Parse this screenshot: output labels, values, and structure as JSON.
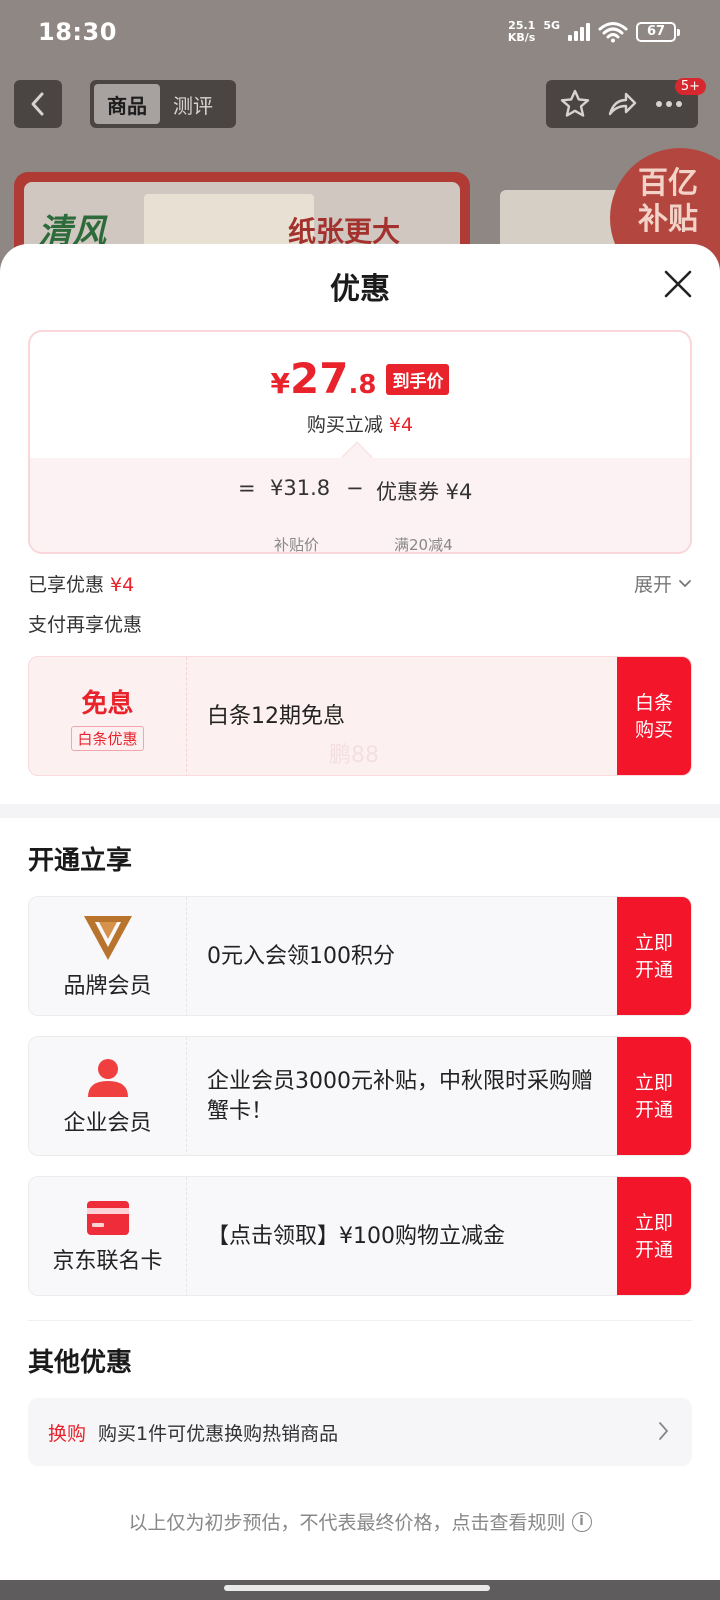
{
  "status_bar": {
    "time": "18:30",
    "net_speed_top": "25.1",
    "net_speed_bottom": "KB/s",
    "network": "5G",
    "wifi_sub": "6",
    "battery": "67"
  },
  "nav": {
    "tab_product": "商品",
    "tab_review": "测评",
    "badge": "5+"
  },
  "banner": {
    "brand": "清风",
    "slogan": "纸张更大",
    "badge_line1": "百亿",
    "badge_line2": "补贴"
  },
  "sheet": {
    "title": "优惠",
    "price": {
      "symbol": "¥",
      "int": "27",
      "dec": ".8",
      "tag": "到手价",
      "save_label": "购买立减",
      "save_amount": "¥4"
    },
    "formula": {
      "eq": "=",
      "subsidy_price": "¥31.8",
      "minus": "−",
      "coupon": "优惠券 ¥4",
      "subsidy_label": "补贴价",
      "coupon_label": "满20减4"
    },
    "enjoyed": {
      "label": "已享优惠",
      "amount": "¥4",
      "expand": "展开"
    },
    "pay_more": "支付再享优惠",
    "baitiao": {
      "title": "免息",
      "tag": "白条优惠",
      "text": "白条12期免息",
      "btn": "白条购买",
      "watermark": "鹏88"
    },
    "open_section_title": "开通立享",
    "members": [
      {
        "label": "品牌会员",
        "text": "0元入会领100积分",
        "btn": "立即开通"
      },
      {
        "label": "企业会员",
        "text": "企业会员3000元补贴，中秋限时采购赠蟹卡！",
        "btn": "立即开通"
      },
      {
        "label": "京东联名卡",
        "text": "【点击领取】¥100购物立减金",
        "btn": "立即开通"
      }
    ],
    "other_section_title": "其他优惠",
    "other": {
      "tag": "换购",
      "text": "购买1件可优惠换购热销商品"
    },
    "footer": "以上仅为初步预估，不代表最终价格，点击查看规则"
  },
  "colors": {
    "accent": "#e8232c",
    "button": "#f3162b"
  }
}
